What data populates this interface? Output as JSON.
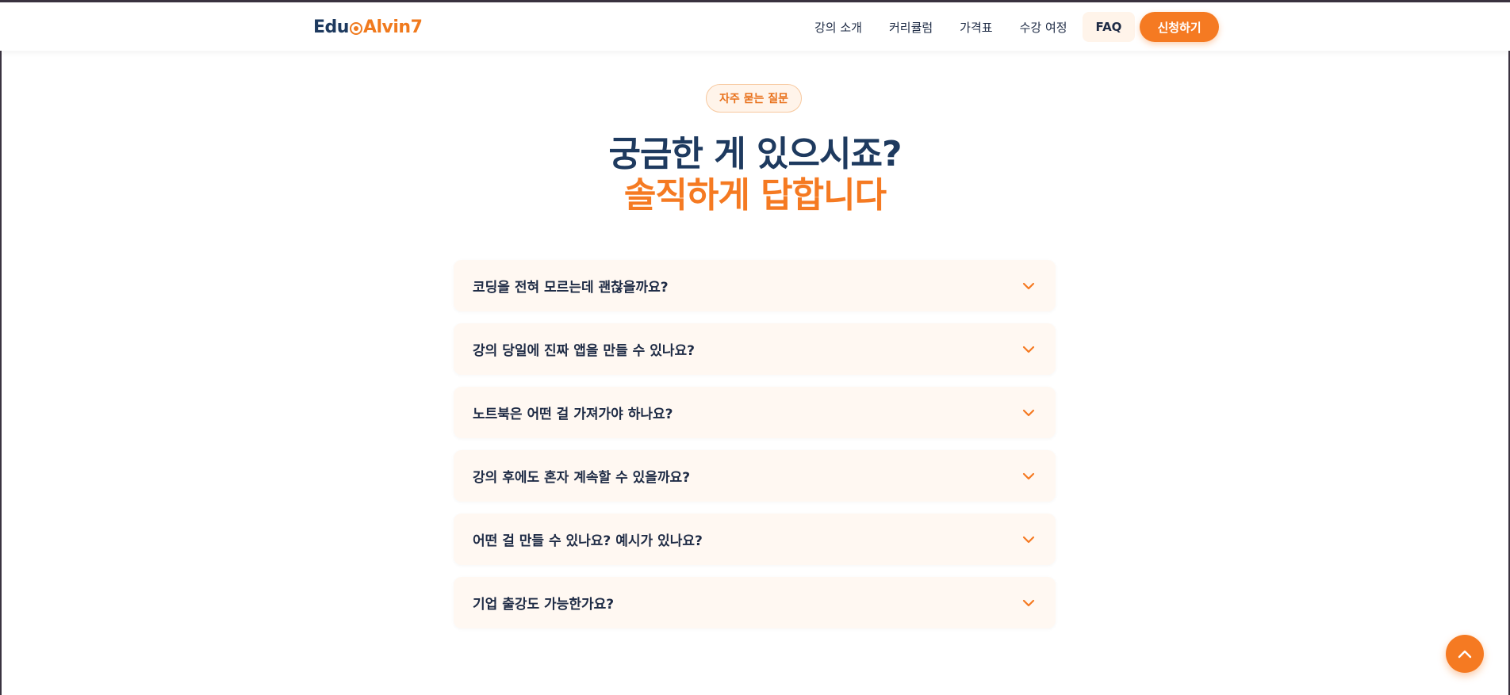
{
  "header": {
    "logo": {
      "part1": "Edu",
      "part2": "Alvin7"
    },
    "nav": [
      {
        "label": "강의 소개"
      },
      {
        "label": "커리큘럼"
      },
      {
        "label": "가격표"
      },
      {
        "label": "수강 여정"
      },
      {
        "label": "FAQ",
        "active": true
      }
    ],
    "cta_label": "신청하기"
  },
  "section": {
    "badge": "자주 묻는 질문",
    "title_line1": "궁금한 게 있으시죠?",
    "title_line2": "솔직하게 답합니다"
  },
  "faq": [
    {
      "question": "코딩을 전혀 모르는데 괜찮을까요?"
    },
    {
      "question": "강의 당일에 진짜 앱을 만들 수 있나요?"
    },
    {
      "question": "노트북은 어떤 걸 가져가야 하나요?"
    },
    {
      "question": "강의 후에도 혼자 계속할 수 있을까요?"
    },
    {
      "question": "어떤 걸 만들 수 있나요? 예시가 있나요?"
    },
    {
      "question": "기업 출강도 가능한가요?"
    }
  ],
  "icons": {
    "faq_toggle": "chevron-down-icon",
    "scroll_top": "chevron-up-icon"
  },
  "colors": {
    "accent": "#f57a22",
    "navy": "#1e3a5f",
    "card_bg": "#fff8f2"
  }
}
